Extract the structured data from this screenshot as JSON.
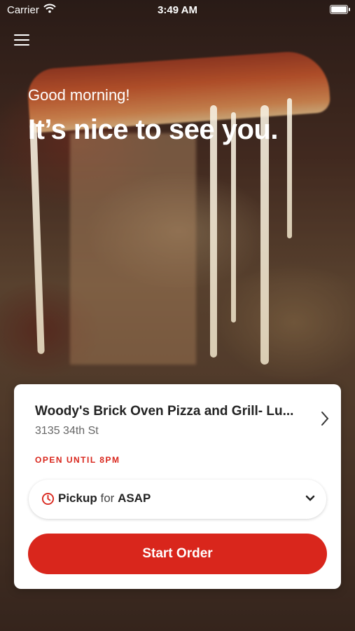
{
  "status_bar": {
    "carrier": "Carrier",
    "time": "3:49 AM"
  },
  "hero": {
    "greeting": "Good morning!",
    "headline": "It’s nice to see you."
  },
  "store": {
    "name": "Woody's Brick Oven Pizza and Grill- Lu...",
    "address": "3135 34th St",
    "hours": "OPEN UNTIL 8PM"
  },
  "order_mode": {
    "mode": "Pickup",
    "joiner": "for",
    "when": "ASAP"
  },
  "actions": {
    "start_order": "Start Order"
  },
  "colors": {
    "accent": "#d9261c"
  },
  "icons": [
    "wifi-icon",
    "battery-icon",
    "menu-icon",
    "chevron-right-icon",
    "clock-icon",
    "chevron-down-icon"
  ]
}
